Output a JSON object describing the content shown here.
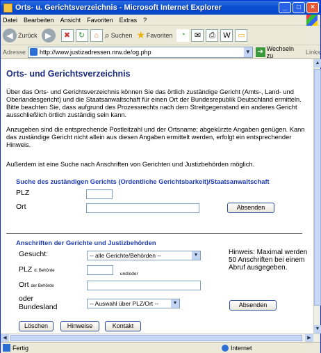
{
  "window": {
    "title": "Orts- u. Gerichtsverzeichnis - Microsoft Internet Explorer"
  },
  "menu": [
    "Datei",
    "Bearbeiten",
    "Ansicht",
    "Favoriten",
    "Extras",
    "?"
  ],
  "toolbar": {
    "back": "Zurück",
    "search": "Suchen",
    "favorites": "Favoriten"
  },
  "address": {
    "label": "Adresse",
    "url": "http://www.justizadressen.nrw.de/og.php",
    "go": "Wechseln zu",
    "links": "Links"
  },
  "page": {
    "title": "Orts- und Gerichtsverzeichnis",
    "intro": "Über das Orts- und Gerichtsverzeichnis können Sie das örtlich zuständige Gericht (Amts-, Land- und Oberlandesgericht) und die Staatsanwaltschaft für einen Ort der Bundesrepublik Deutschland ermitteln. Bitte beachten Sie, dass aufgrund des Prozessrechts nach dem Streitgegenstand ein anderes Gericht ausschließlich örtlich zuständig sein kann.",
    "intro2": "Anzugeben sind die entsprechende Postleitzahl und der Ortsname; abgekürzte Angaben genügen. Kann das zuständige Gericht nicht allein aus diesen Angaben ermittelt werden, erfolgt ein entsprechender Hinweis.",
    "intro3": "Außerdem ist eine Suche nach Anschriften von Gerichten und Justizbehörden möglich."
  },
  "search1": {
    "title": "Suche des zuständigen Gerichts (Ordentliche Gerichtsbarkeit)/Staatsanwaltschaft",
    "plz_label": "PLZ",
    "ort_label": "Ort",
    "submit": "Absenden"
  },
  "search2": {
    "title": "Anschriften der Gerichte und Justizbehörden",
    "gesucht_label": "Gesucht:",
    "gesucht_value": "-- alle Gerichte/Behörden --",
    "plz_label": "PLZ",
    "plz_sub": "d. Behörde",
    "und_oder": "und/oder",
    "ort_label": "Ort",
    "ort_sub": "der Behörde",
    "oder": "oder",
    "bundesland": "Bundesland",
    "bundesland_value": "-- Auswahl über PLZ/Ort --",
    "submit": "Absenden",
    "hint": "Hinweis: Maximal werden 50 Anschriften bei einem Abruf ausgegeben."
  },
  "buttons": {
    "loeschen": "Löschen",
    "hinweise": "Hinweise",
    "kontakt": "Kontakt"
  },
  "status": {
    "text": "Fertig",
    "zone": "Internet"
  }
}
